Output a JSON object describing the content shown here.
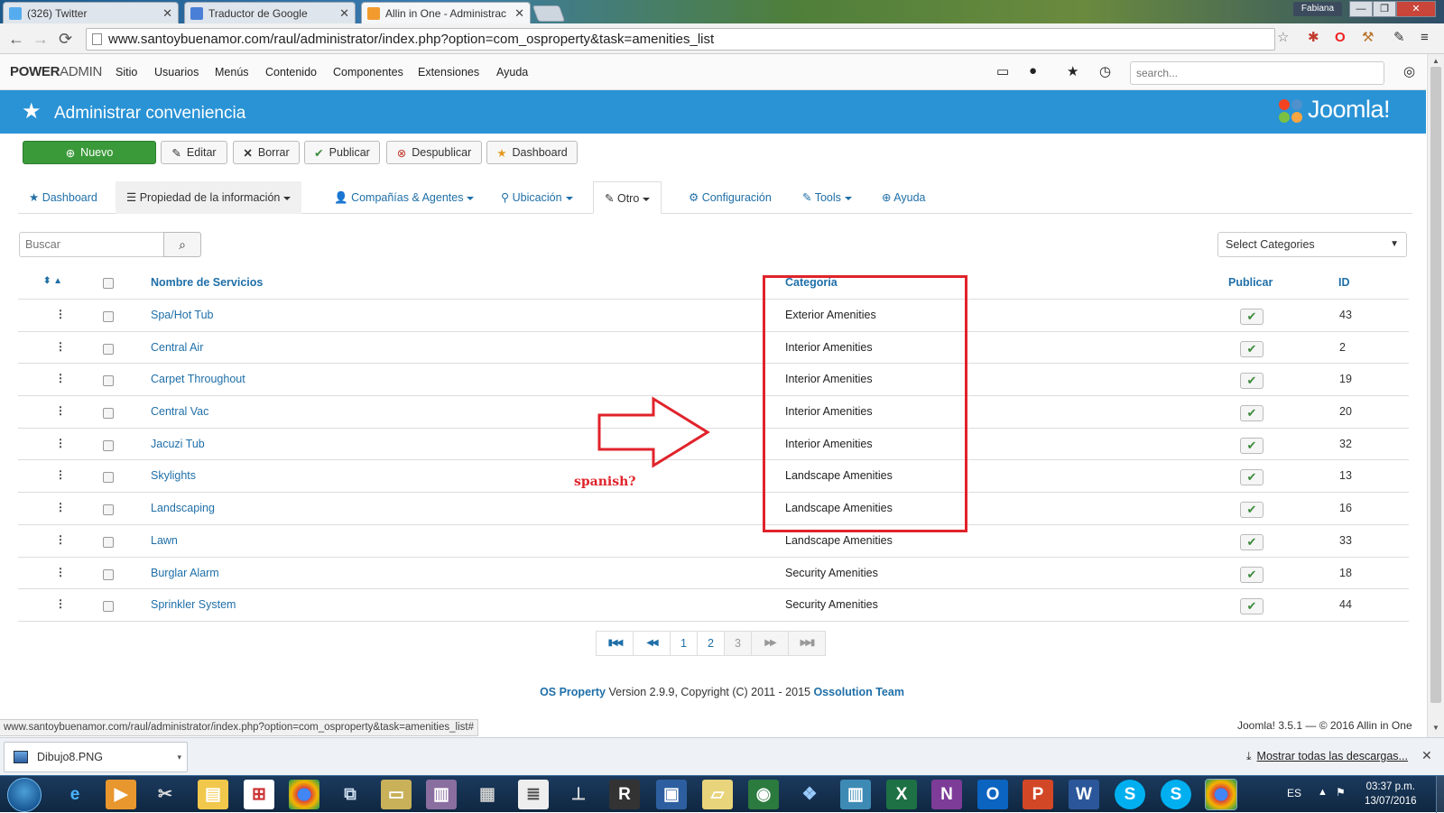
{
  "browser": {
    "tabs": [
      {
        "label": "(326) Twitter",
        "icon_color": "#55acee"
      },
      {
        "label": "Traductor de Google",
        "icon_color": "#4a7fd8"
      },
      {
        "label": "Allin in One - Administrac",
        "icon_color": "#f29a2e"
      }
    ],
    "user": "Fabiana",
    "url": "www.santoybuenamor.com/raul/administrator/index.php?option=com_osproperty&task=amenities_list",
    "status_url": "www.santoybuenamor.com/raul/administrator/index.php?option=com_osproperty&task=amenities_list#"
  },
  "topnav": {
    "brand_bold": "POWER",
    "brand_rest": "ADMIN",
    "menu": [
      "Sitio",
      "Usuarios",
      "Menús",
      "Contenido",
      "Componentes",
      "Extensiones",
      "Ayuda"
    ],
    "search_placeholder": "search..."
  },
  "header": {
    "title": "Administrar conveniencia",
    "logo": "Joomla!",
    "bar_color": "#2a93d5"
  },
  "toolbar": {
    "new": "Nuevo",
    "edit": "Editar",
    "delete": "Borrar",
    "publish": "Publicar",
    "unpublish": "Despublicar",
    "dashboard": "Dashboard"
  },
  "subnav": {
    "items": [
      "Dashboard",
      "Propiedad de la información",
      "Compañías & Agentes",
      "Ubicación",
      "Otro",
      "Configuración",
      "Tools",
      "Ayuda"
    ]
  },
  "filters": {
    "search_placeholder": "Buscar",
    "category_select": "Select Categories"
  },
  "table": {
    "headers": {
      "name": "Nombre de Servicios",
      "category": "Categoría",
      "publish": "Publicar",
      "id": "ID"
    },
    "rows": [
      {
        "name": "Spa/Hot Tub",
        "category": "Exterior Amenities",
        "id": "43"
      },
      {
        "name": "Central Air",
        "category": "Interior Amenities",
        "id": "2"
      },
      {
        "name": "Carpet Throughout",
        "category": "Interior Amenities",
        "id": "19"
      },
      {
        "name": "Central Vac",
        "category": "Interior Amenities",
        "id": "20"
      },
      {
        "name": "Jacuzi Tub",
        "category": "Interior Amenities",
        "id": "32"
      },
      {
        "name": "Skylights",
        "category": "Landscape Amenities",
        "id": "13"
      },
      {
        "name": "Landscaping",
        "category": "Landscape Amenities",
        "id": "16"
      },
      {
        "name": "Lawn",
        "category": "Landscape Amenities",
        "id": "33"
      },
      {
        "name": "Burglar Alarm",
        "category": "Security Amenities",
        "id": "18"
      },
      {
        "name": "Sprinkler System",
        "category": "Security Amenities",
        "id": "44"
      }
    ]
  },
  "annotation": {
    "note": "spanish?",
    "color": "#e0232b"
  },
  "pagination": {
    "pages": [
      "1",
      "2",
      "3"
    ],
    "current": "3"
  },
  "credits": {
    "product": "OS Property",
    "middle": " Version 2.9.9, Copyright (C) 2011 - 2015 ",
    "team": "Ossolution Team"
  },
  "footer": {
    "text": "Joomla! 3.5.1  —  © 2016 Allin in One"
  },
  "downloads": {
    "file": "Dibujo8.PNG",
    "show_all": "Mostrar todas las descargas..."
  },
  "taskbar": {
    "lang": "ES",
    "time": "03:37 p.m.",
    "date": "13/07/2016"
  }
}
